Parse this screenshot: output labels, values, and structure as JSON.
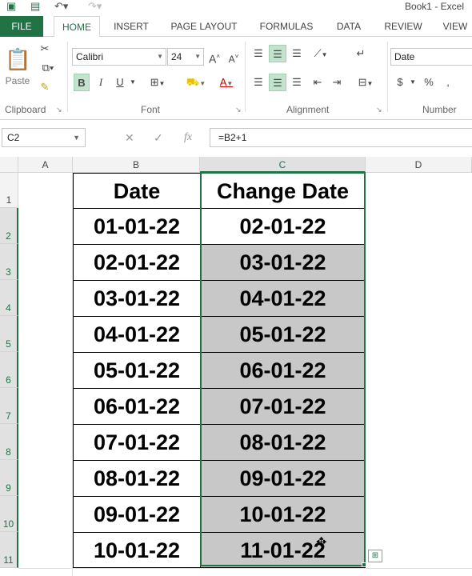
{
  "window": {
    "title": "Book1 - Excel"
  },
  "tabs": [
    {
      "label": "FILE"
    },
    {
      "label": "HOME"
    },
    {
      "label": "INSERT"
    },
    {
      "label": "PAGE LAYOUT"
    },
    {
      "label": "FORMULAS"
    },
    {
      "label": "DATA"
    },
    {
      "label": "REVIEW"
    },
    {
      "label": "VIEW"
    }
  ],
  "ribbon": {
    "clipboard": {
      "label": "Clipboard",
      "paste": "Paste"
    },
    "font": {
      "label": "Font",
      "name": "Calibri",
      "size": "24",
      "bold": "B",
      "italic": "I",
      "underline": "U"
    },
    "alignment": {
      "label": "Alignment"
    },
    "number": {
      "label": "Number",
      "format": "Date",
      "currency": "$",
      "percent": "%"
    }
  },
  "formula_bar": {
    "name_box": "C2",
    "formula": "=B2+1",
    "fx": "fx"
  },
  "columns": [
    {
      "label": "A"
    },
    {
      "label": "B"
    },
    {
      "label": "C"
    },
    {
      "label": "D"
    }
  ],
  "rows": [
    "1",
    "2",
    "3",
    "4",
    "5",
    "6",
    "7",
    "8",
    "9",
    "10",
    "11"
  ],
  "table": {
    "headers": [
      "Date",
      "Change Date"
    ],
    "rows": [
      [
        "01-01-22",
        "02-01-22"
      ],
      [
        "02-01-22",
        "03-01-22"
      ],
      [
        "03-01-22",
        "04-01-22"
      ],
      [
        "04-01-22",
        "05-01-22"
      ],
      [
        "05-01-22",
        "06-01-22"
      ],
      [
        "06-01-22",
        "07-01-22"
      ],
      [
        "07-01-22",
        "08-01-22"
      ],
      [
        "08-01-22",
        "09-01-22"
      ],
      [
        "09-01-22",
        "10-01-22"
      ],
      [
        "10-01-22",
        "11-01-22"
      ]
    ]
  },
  "colors": {
    "accent": "#217346",
    "shade": "#c8c8c8"
  }
}
